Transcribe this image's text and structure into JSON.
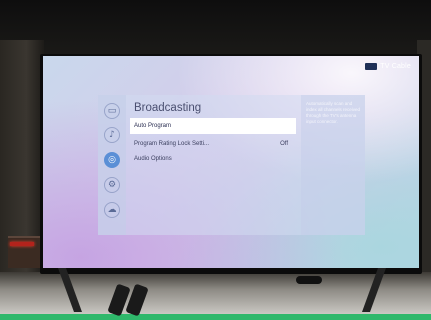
{
  "tv": {
    "source": {
      "icon": "tv-source-icon",
      "label": "TV Cable"
    },
    "menu": {
      "title": "Broadcasting",
      "rail_icons": [
        {
          "icon": "picture-icon",
          "glyph": "▭"
        },
        {
          "icon": "sound-icon",
          "glyph": "♪"
        },
        {
          "icon": "broadcast-icon",
          "glyph": "◎",
          "active": true
        },
        {
          "icon": "general-icon",
          "glyph": "⚙"
        },
        {
          "icon": "support-icon",
          "glyph": "☁"
        }
      ],
      "items": [
        {
          "label": "Auto Program",
          "value": "",
          "selected": true
        },
        {
          "label": "Program Rating Lock Setti...",
          "value": "Off",
          "selected": false
        },
        {
          "label": "Audio Options",
          "value": "",
          "selected": false
        }
      ],
      "help_text": "Automatically scan and index all channels received through the TV's antenna input connector."
    }
  }
}
